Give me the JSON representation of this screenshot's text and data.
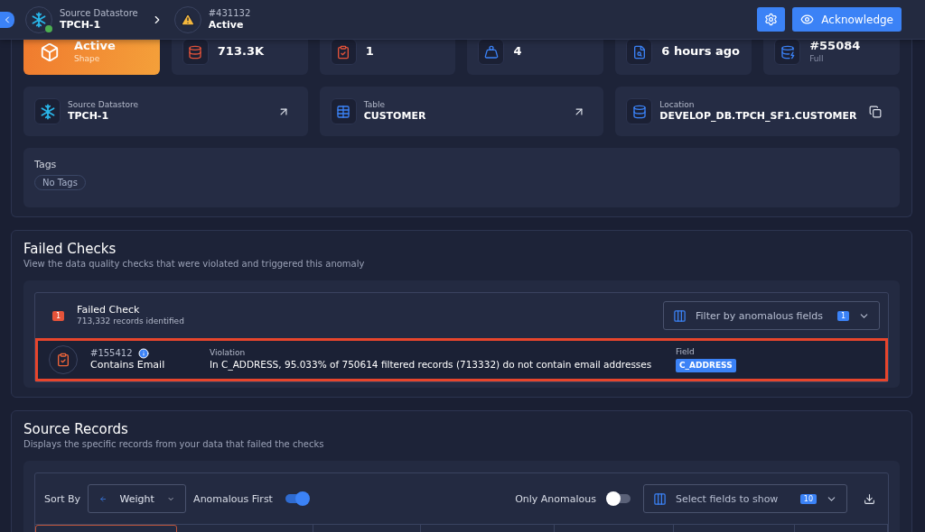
{
  "header": {
    "datastore": {
      "label": "Source Datastore",
      "name": "TPCH-1",
      "online": true
    },
    "anomaly": {
      "id": "#431132",
      "status": "Active"
    },
    "acknowledge": "Acknowledge"
  },
  "summary_cards": [
    {
      "kind": "highlight",
      "value": "Active",
      "sub": "Shape"
    },
    {
      "kind": "stat",
      "value": "713.3K"
    },
    {
      "kind": "stat",
      "value": "1"
    },
    {
      "kind": "stat",
      "value": "4"
    },
    {
      "kind": "stat",
      "value": "6 hours ago"
    },
    {
      "kind": "stat",
      "value": "#55084",
      "sub": "Full"
    }
  ],
  "details": [
    {
      "label": "Source Datastore",
      "value": "TPCH-1",
      "kind": "link"
    },
    {
      "label": "Table",
      "value": "CUSTOMER",
      "kind": "link"
    },
    {
      "label": "Location",
      "value": "DEVELOP_DB.TPCH_SF1.CUSTOMER",
      "kind": "copy"
    }
  ],
  "tags": {
    "label": "Tags",
    "empty_text": "No Tags"
  },
  "failed_checks": {
    "title": "Failed Checks",
    "subtitle": "View the data quality checks that were violated and triggered this anomaly",
    "count": "1",
    "group_title": "Failed Check",
    "records": "713,332 records identified",
    "filter": {
      "placeholder": "Filter by anomalous fields",
      "count": "1"
    },
    "checks": [
      {
        "id": "#155412",
        "name": "Contains Email",
        "violation_label": "Violation",
        "violation": "In C_ADDRESS, 95.033% of 750614 filtered records (713332) do not contain email addresses",
        "field_label": "Field",
        "fields": [
          "C_ADDRESS"
        ],
        "selected": true
      }
    ]
  },
  "source_records": {
    "title": "Source Records",
    "subtitle": "Displays the specific records from your data that failed the checks",
    "sort_label": "Sort By",
    "sort_value": "Weight",
    "toggles": [
      {
        "label": "Anomalous First",
        "on": true
      },
      {
        "label": "Only Anomalous",
        "on": false
      }
    ],
    "fields_select": {
      "placeholder": "Select fields to show",
      "count": "10"
    },
    "columns": [
      {
        "selected": true
      },
      {
        "selected": false
      },
      {
        "selected": false
      },
      {
        "selected": false
      },
      {
        "selected": false
      },
      {
        "selected": false
      },
      {
        "selected": false
      }
    ]
  }
}
